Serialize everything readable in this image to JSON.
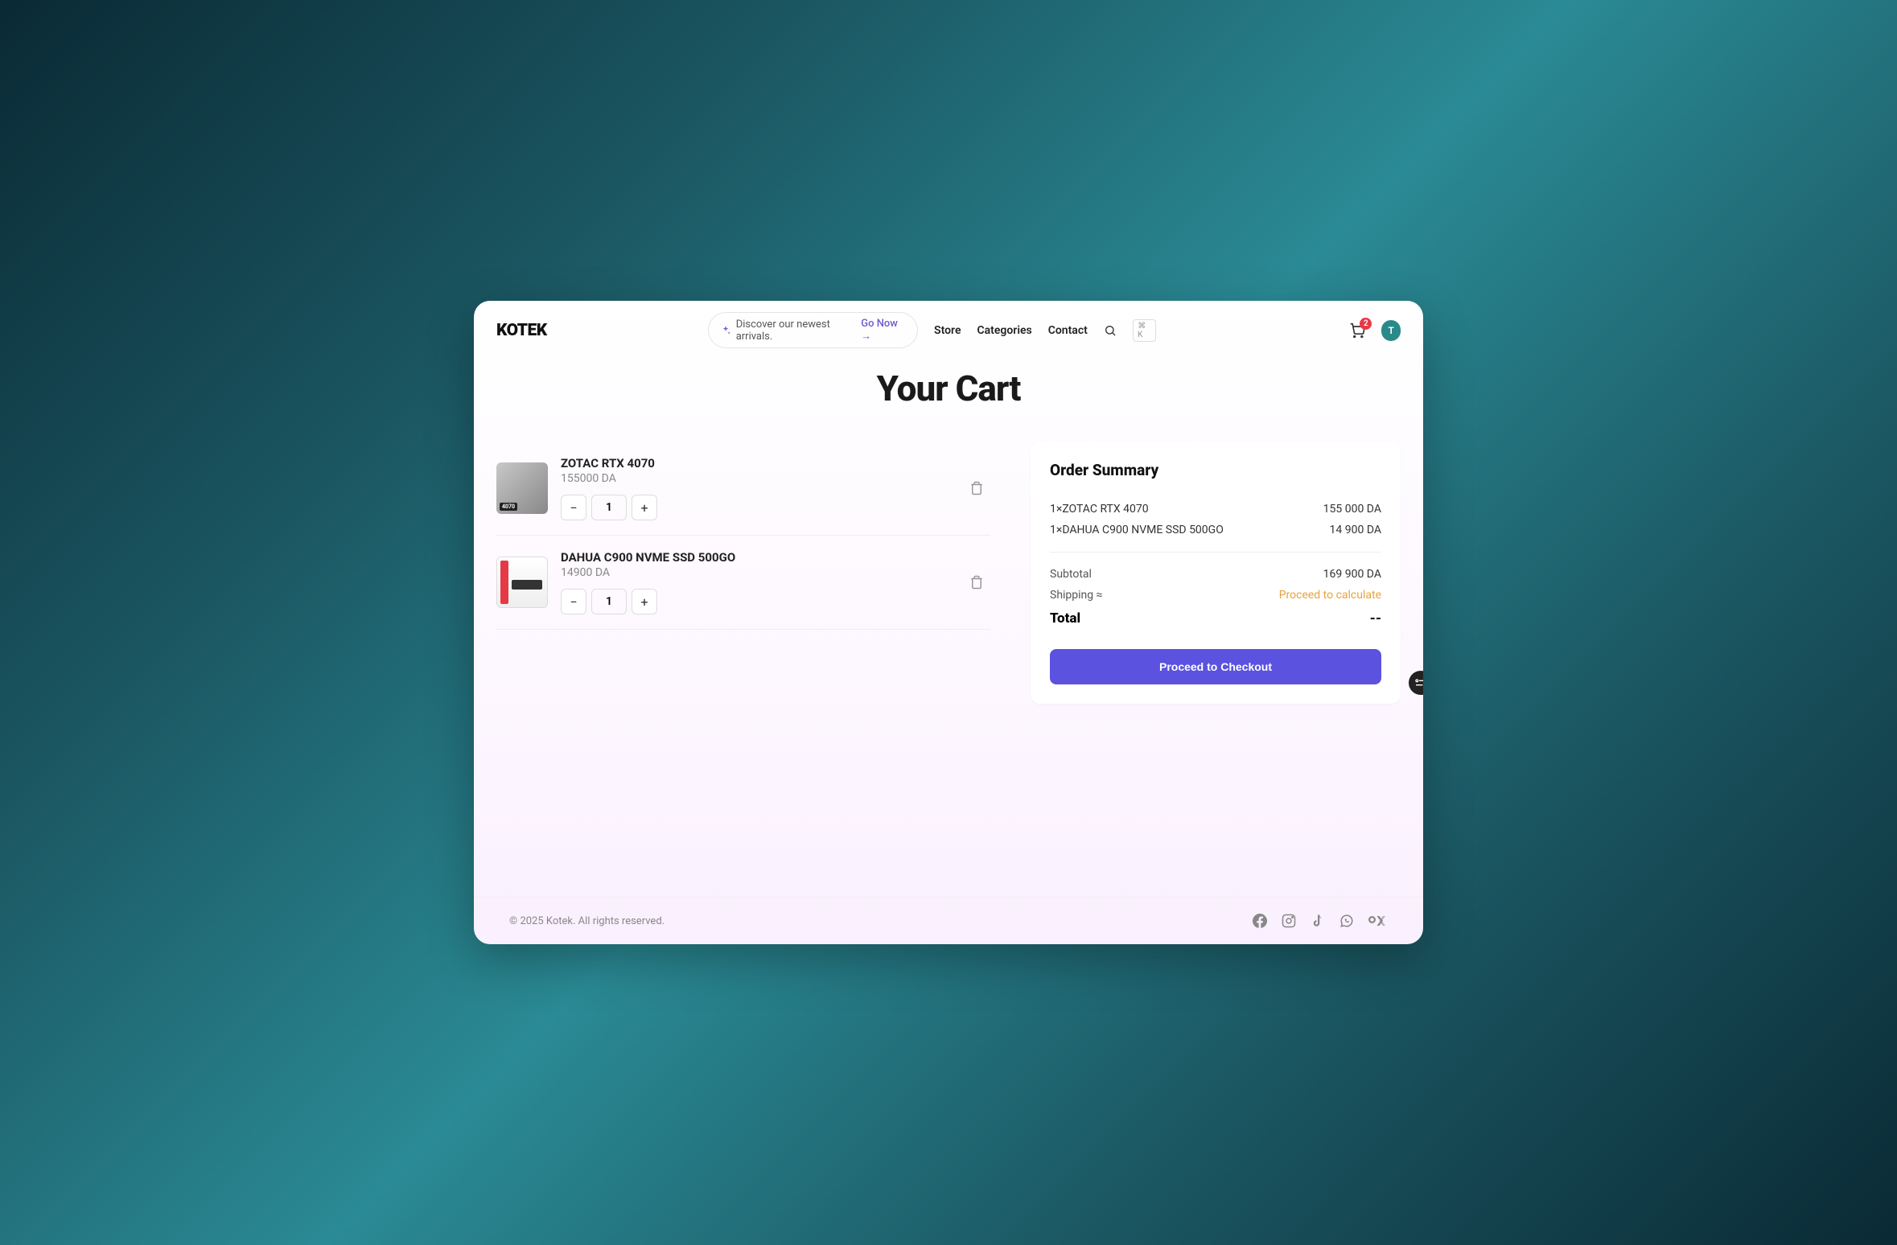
{
  "brand": "KOTEK",
  "discover": {
    "text": "Discover our newest arrivals.",
    "cta": "Go Now →"
  },
  "nav": {
    "store": "Store",
    "categories": "Categories",
    "contact": "Contact"
  },
  "kbd_hint": "⌘ K",
  "cart_count": "2",
  "avatar_initial": "T",
  "page_title": "Your Cart",
  "items": [
    {
      "name": "ZOTAC RTX 4070",
      "price": "155000 DA",
      "qty": "1"
    },
    {
      "name": "DAHUA C900 NVME SSD 500GO",
      "price": "14900 DA",
      "qty": "1"
    }
  ],
  "summary": {
    "heading": "Order Summary",
    "lines": [
      {
        "label": "1×ZOTAC RTX 4070",
        "value": "155 000 DA"
      },
      {
        "label": "1×DAHUA C900 NVME SSD 500GO",
        "value": "14 900 DA"
      }
    ],
    "subtotal_label": "Subtotal",
    "subtotal_value": "169 900 DA",
    "shipping_label": "Shipping ≈",
    "shipping_cta": "Proceed to calculate",
    "total_label": "Total",
    "total_value": "--",
    "checkout": "Proceed to Checkout"
  },
  "footer": {
    "copyright": "© 2025 Kotek. All rights reserved."
  }
}
